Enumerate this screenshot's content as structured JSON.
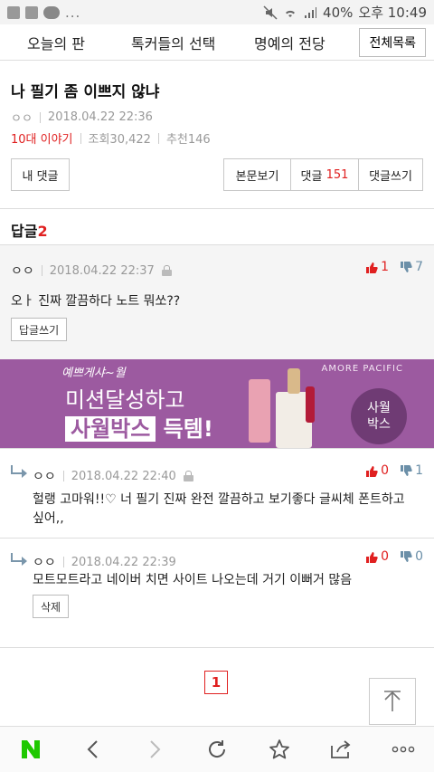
{
  "status_bar": {
    "ellipsis": "...",
    "battery": "40%",
    "time": "오후 10:49"
  },
  "topnav": {
    "tabs": [
      "오늘의 판",
      "톡커들의 선택",
      "명예의 전당"
    ],
    "full_list": "전체목록"
  },
  "post": {
    "title": "나 필기 좀 이쁘지 않냐",
    "author": "ㅇㅇ",
    "date": "2018.04.22 22:36",
    "category": "10대 이야기",
    "views": "조회30,422",
    "recommend": "추천146"
  },
  "buttons": {
    "my_comments": "내 댓글",
    "view_body": "본문보기",
    "comments": "댓글",
    "comment_count": "151",
    "write_comment": "댓글쓰기"
  },
  "reply_section": {
    "label": "답글",
    "count": "2"
  },
  "comments": [
    {
      "author": "ㅇㅇ",
      "date": "2018.04.22 22:37",
      "body": "오ㅏ 진짜 깔끔하다 노트 뭐쏘??",
      "up": "1",
      "down": "7",
      "action": "답글쓰기"
    },
    {
      "author": "ㅇㅇ",
      "date": "2018.04.22 22:40",
      "body": "헐랭 고마워!!♡ 너 필기 진짜 완전 깔끔하고 보기좋다 글씨체 폰트하고 싶어,,",
      "up": "0",
      "down": "1"
    },
    {
      "author": "ㅇㅇ",
      "date": "2018.04.22 22:39",
      "body": "모트모트라고 네이버 치면 사이트 나오는데 거기 이뻐거 많음",
      "up": "0",
      "down": "0",
      "action": "삭제"
    }
  ],
  "banner": {
    "brand": "예쁘게샤~월",
    "company": "AMORE PACIFIC",
    "line1": "미션달성하고",
    "line2_box": "사월박스",
    "line2_rest": " 득템!",
    "circle": "사월\n박스",
    "bg_color": "#9c5aa0"
  },
  "pagination": {
    "current": "1"
  },
  "accent_color": "#e02020"
}
